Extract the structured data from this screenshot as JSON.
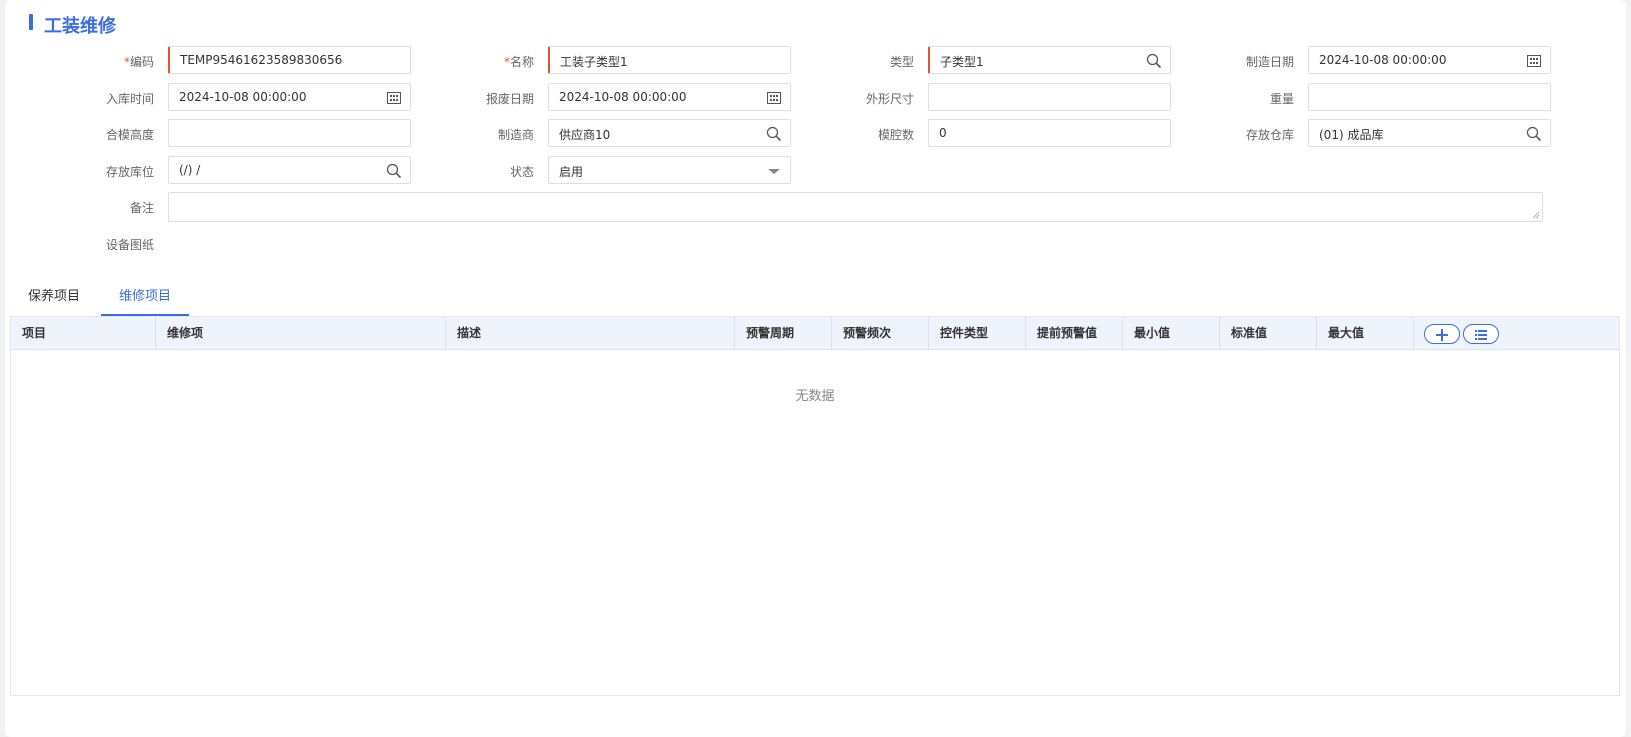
{
  "page": {
    "title": "工装维修"
  },
  "form": {
    "code": {
      "label": "编码",
      "required_mark": "*",
      "value": "TEMP95461623589830656"
    },
    "name": {
      "label": "名称",
      "required_mark": "*",
      "value": "工装子类型1"
    },
    "type": {
      "label": "类型",
      "value": "子类型1"
    },
    "manufacture_date": {
      "label": "制造日期",
      "value": "2024-10-08 00:00:00"
    },
    "storage_time": {
      "label": "入库时间",
      "value": "2024-10-08 00:00:00"
    },
    "scrap_date": {
      "label": "报废日期",
      "value": "2024-10-08 00:00:00"
    },
    "dimensions": {
      "label": "外形尺寸",
      "value": ""
    },
    "weight": {
      "label": "重量",
      "value": ""
    },
    "mold_height": {
      "label": "合模高度",
      "value": ""
    },
    "manufacturer": {
      "label": "制造商",
      "value": "供应商10"
    },
    "cavity_count": {
      "label": "模腔数",
      "value": "0"
    },
    "warehouse": {
      "label": "存放仓库",
      "value": "(01) 成品库"
    },
    "location": {
      "label": "存放库位",
      "value": "(/) /"
    },
    "status": {
      "label": "状态",
      "value": "启用"
    },
    "remark": {
      "label": "备注",
      "value": ""
    },
    "drawing": {
      "label": "设备图纸"
    }
  },
  "tabs": [
    {
      "label": "保养项目",
      "active": false
    },
    {
      "label": "维修项目",
      "active": true
    }
  ],
  "grid": {
    "columns": [
      "项目",
      "维修项",
      "描述",
      "预警周期",
      "预警频次",
      "控件类型",
      "提前预警值",
      "最小值",
      "标准值",
      "最大值"
    ],
    "empty_text": "无数据"
  },
  "colors": {
    "accent": "#3b6ee0",
    "required": "#e4572e"
  }
}
